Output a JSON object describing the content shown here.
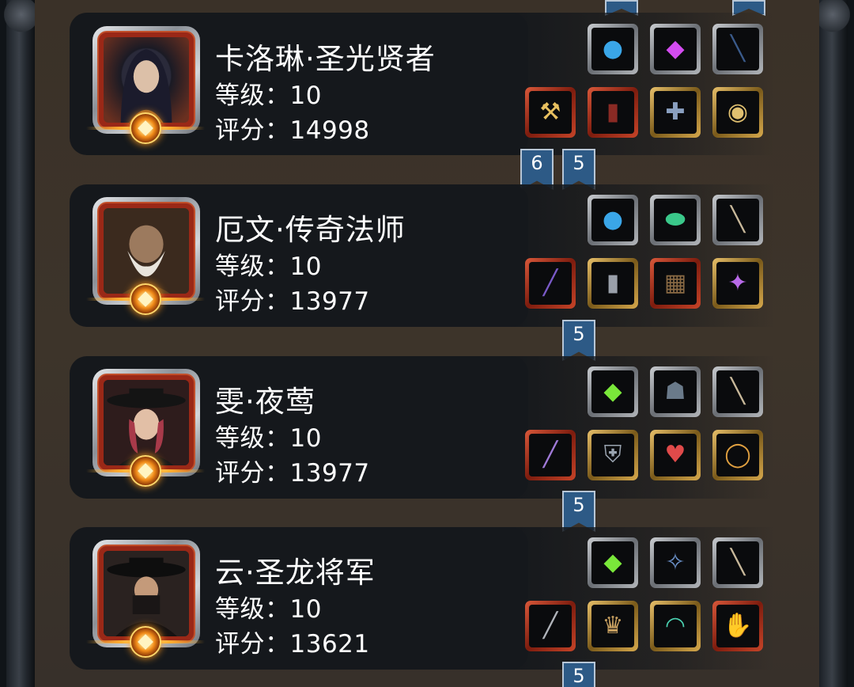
{
  "heroes": [
    {
      "name": "卡洛琳·圣光贤者",
      "level_label": "等级：10",
      "score_label": "评分：14998"
    },
    {
      "name": "厄文·传奇法师",
      "level_label": "等级：10",
      "score_label": "评分：13977"
    },
    {
      "name": "雯·夜莺",
      "level_label": "等级：10",
      "score_label": "评分：13977"
    },
    {
      "name": "云·圣龙将军",
      "level_label": "等级：10",
      "score_label": "评分：13621"
    }
  ],
  "link_badges": [
    {
      "label": "6"
    },
    {
      "label": "5"
    },
    {
      "label": "5"
    },
    {
      "label": "5"
    },
    {
      "label": "5"
    }
  ],
  "colors": {
    "panel": "#3a3128",
    "card": "#15181c",
    "ribbon": "#2d5a86",
    "portrait_frame": "#9a2817"
  }
}
